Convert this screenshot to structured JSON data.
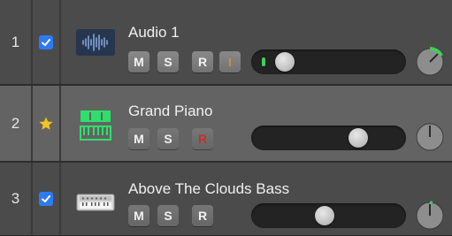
{
  "tracks": [
    {
      "number": "1",
      "status": "checkbox",
      "name": "Audio 1",
      "icon": "audio-waveform-icon",
      "mute_label": "M",
      "solo_label": "S",
      "record_label": "R",
      "input_monitor_label": "I",
      "volume_level": 0.14,
      "pan_knob": "green-arc",
      "selected": false
    },
    {
      "number": "2",
      "status": "star",
      "name": "Grand Piano",
      "icon": "keyboard-instrument-icon",
      "mute_label": "M",
      "solo_label": "S",
      "record_label": "R",
      "volume_level": 0.82,
      "selected": true
    },
    {
      "number": "3",
      "status": "checkbox",
      "name": "Above The Clouds Bass",
      "icon": "synthesizer-icon",
      "mute_label": "M",
      "solo_label": "S",
      "record_label": "R",
      "volume_level": 0.5,
      "selected": false
    }
  ],
  "colors": {
    "checkbox_blue": "#2d7bf4",
    "star_yellow": "#f4c320",
    "meter_green": "#3fd05a",
    "input_orange": "#f09a1a",
    "record_red": "#c03030"
  }
}
